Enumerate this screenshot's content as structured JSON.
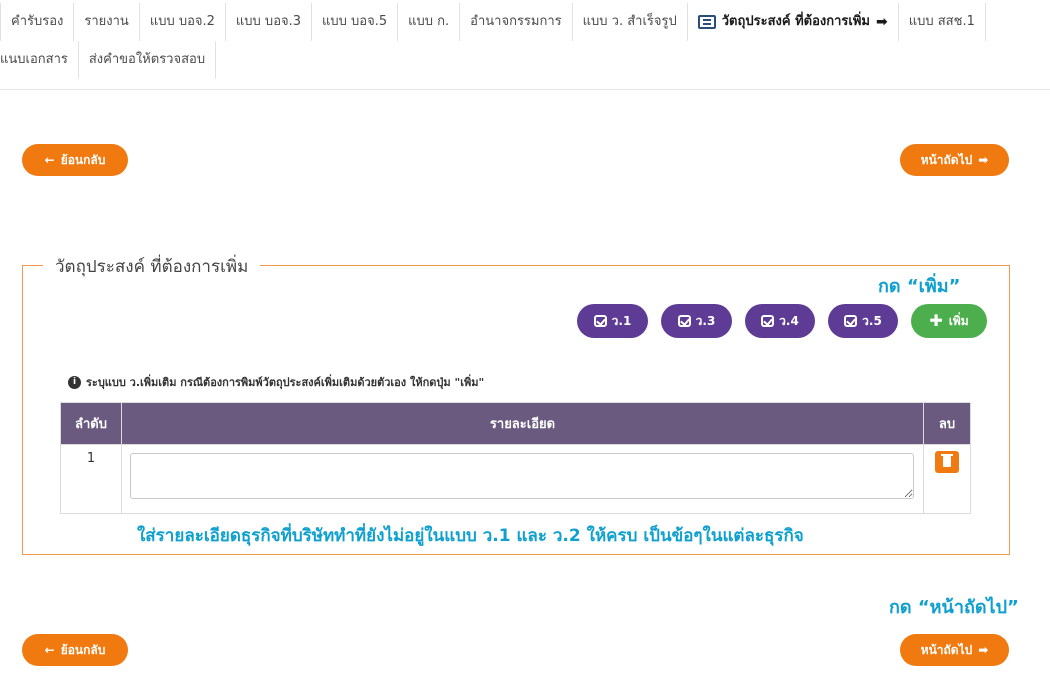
{
  "tabs": {
    "row1": [
      "คำรับรอง",
      "รายงาน",
      "แบบ บอจ.2",
      "แบบ บอจ.3",
      "แบบ บอจ.5",
      "แบบ ก.",
      "อำนาจกรรมการ",
      "แบบ ว. สำเร็จรูป",
      "วัตถุประสงค์ ที่ต้องการเพิ่ม",
      "แบบ สสช.1"
    ],
    "active_arrow": "➡",
    "row2": [
      "แนบเอกสาร",
      "ส่งคำขอให้ตรวจสอบ"
    ]
  },
  "nav": {
    "back_label": "ย้อนกลับ",
    "next_label": "หน้าถัดไป",
    "back_icon": "arrow-left-icon",
    "next_icon": "arrow-right-icon"
  },
  "section": {
    "legend": "วัตถุประสงค์ ที่ต้องการเพิ่ม",
    "annotation_add": "กด “เพิ่ม”",
    "annotation_next": "กด “หน้าถัดไป”",
    "annotation_detail": "ใส่รายละเอียดธุรกิจที่บริษัททำที่ยังไม่อยู่ในแบบ ว.1 และ ว.2 ให้ครบ เป็นข้อๆในแต่ละธุรกิจ",
    "buttons": [
      "ว.1",
      "ว.3",
      "ว.4",
      "ว.5"
    ],
    "add_label": "เพิ่ม",
    "note": "ระบุแบบ ว.เพิ่มเติม กรณีต้องการพิมพ์วัตถุประสงค์เพิ่มเติมด้วยตัวเอง ให้กดปุ่ม \"เพิ่ม\""
  },
  "table": {
    "headers": [
      "ลำดับ",
      "รายละเอียด",
      "ลบ"
    ],
    "rows": [
      {
        "no": "1",
        "detail": ""
      }
    ]
  },
  "colors": {
    "accent_orange": "#f07a10",
    "purple": "#5e3c96",
    "green": "#4cae4c",
    "table_header": "#6b5a80",
    "annotation": "#0fa0cf"
  }
}
